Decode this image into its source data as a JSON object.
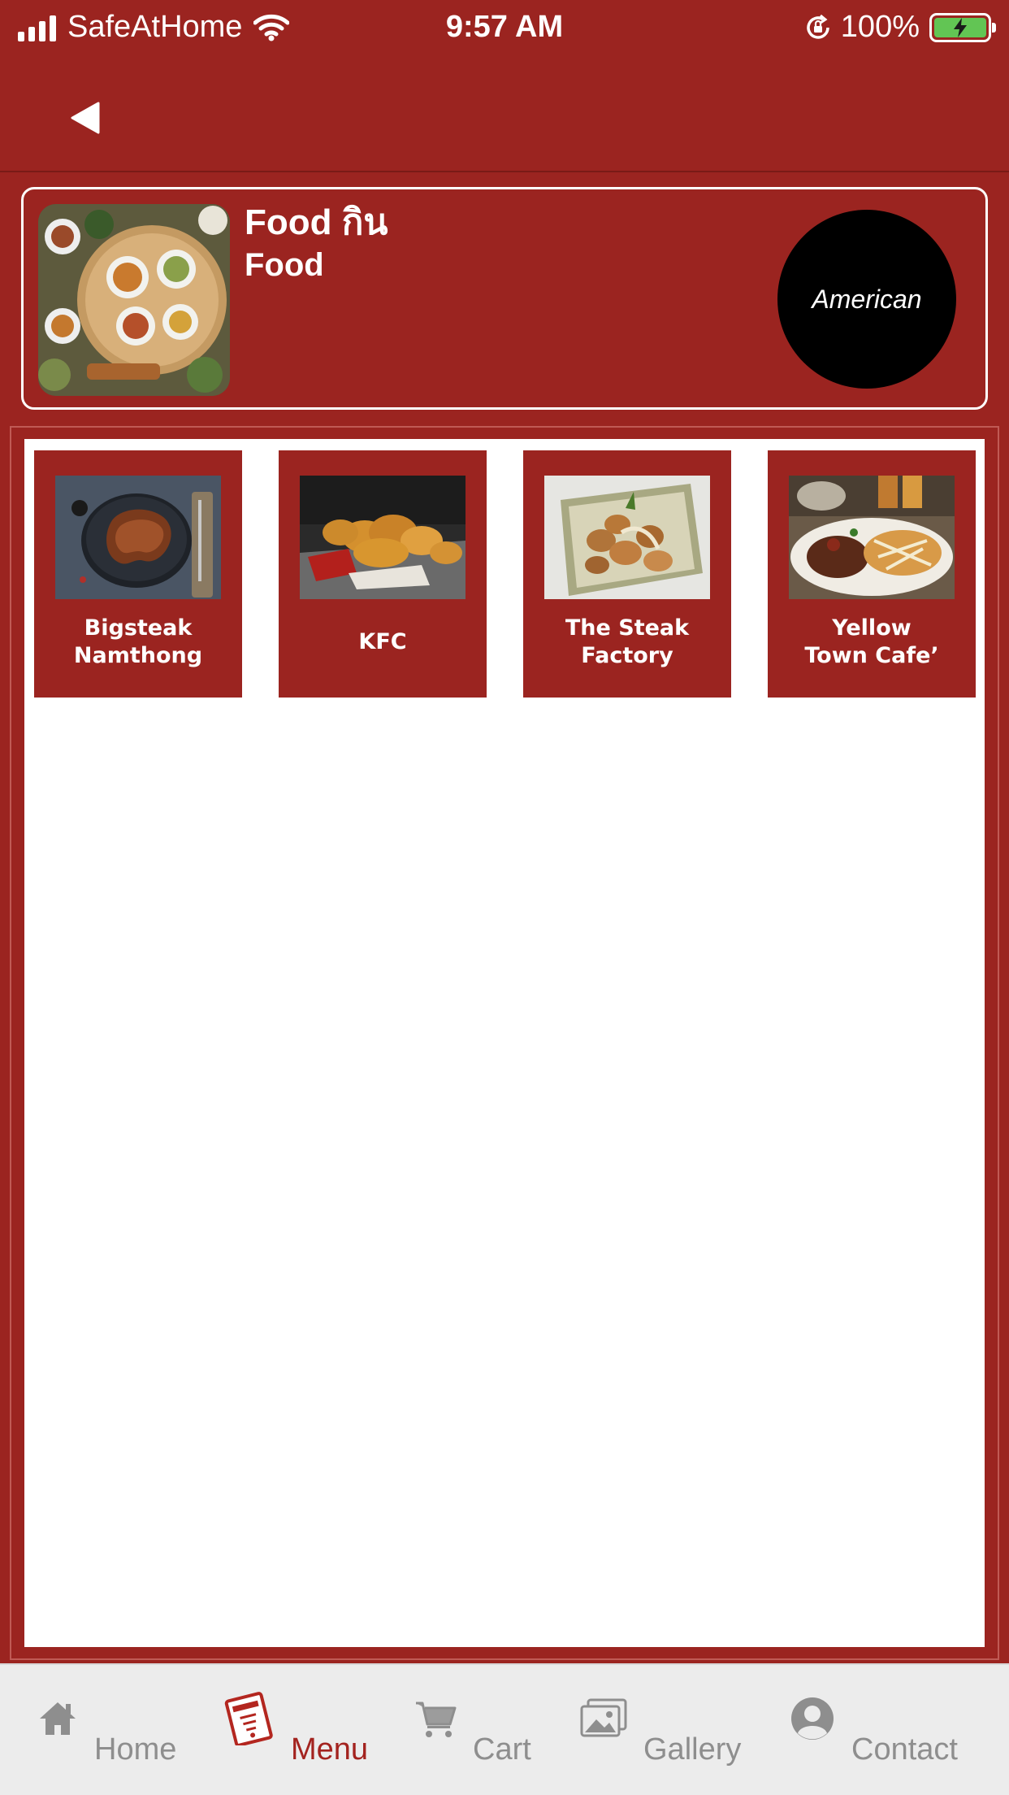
{
  "status_bar": {
    "carrier": "SafeAtHome",
    "time": "9:57 AM",
    "battery": "100%"
  },
  "header": {
    "title": "Food กิน",
    "subtitle": "Food",
    "category": "American"
  },
  "restaurants": [
    {
      "name": "Bigsteak\nNamthong",
      "image": "steak-photo"
    },
    {
      "name": "KFC",
      "image": "fried-chicken-photo"
    },
    {
      "name": "The Steak\nFactory",
      "image": "pork-potatoes-photo"
    },
    {
      "name": "Yellow\nTown Cafe’",
      "image": "steak-plate-photo"
    }
  ],
  "tabs": [
    {
      "label": "Home",
      "icon": "home-icon"
    },
    {
      "label": "Menu",
      "icon": "menu-book-icon",
      "active": true
    },
    {
      "label": "Cart",
      "icon": "cart-icon"
    },
    {
      "label": "Gallery",
      "icon": "gallery-icon"
    },
    {
      "label": "Contact",
      "icon": "contact-icon"
    }
  ],
  "colors": {
    "brand": "#9b2420",
    "active_tab": "#a3231f",
    "inactive_tab": "#8e8e8e",
    "tab_bar": "#ececec"
  }
}
